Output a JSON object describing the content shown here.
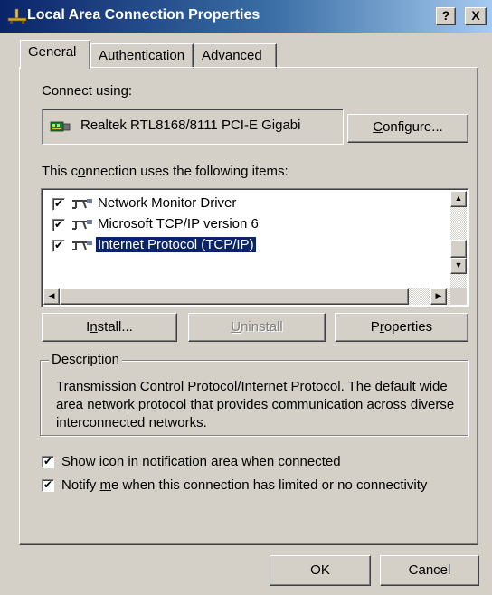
{
  "window": {
    "title": "Local Area Connection Properties"
  },
  "caption_buttons": {
    "help": "?",
    "close": "X"
  },
  "tabs": [
    {
      "label": "General"
    },
    {
      "label": "Authentication"
    },
    {
      "label": "Advanced"
    }
  ],
  "connect_using": {
    "label_pre": "C",
    "label_accel": "",
    "label_post": "onnect using:",
    "adapter": "Realtek RTL8168/8111 PCI-E Gigabi",
    "configure_pre": "",
    "configure_accel": "C",
    "configure_post": "onfigure..."
  },
  "items_label": {
    "pre": "This c",
    "accel": "o",
    "post": "nnection uses the following items:"
  },
  "items": [
    {
      "label": "Network Monitor Driver",
      "checked": true
    },
    {
      "label": "Microsoft TCP/IP version 6",
      "checked": true
    },
    {
      "label": "Internet Protocol (TCP/IP)",
      "checked": true,
      "selected": true
    }
  ],
  "check_mark": "✔",
  "buttons": {
    "install": {
      "pre": "I",
      "accel": "n",
      "post": "stall..."
    },
    "uninstall": {
      "pre": "",
      "accel": "U",
      "post": "ninstall"
    },
    "properties": {
      "pre": "P",
      "accel": "r",
      "post": "operties"
    },
    "ok": "OK",
    "cancel": "Cancel"
  },
  "description": {
    "legend": "Description",
    "text": "Transmission Control Protocol/Internet Protocol. The default wide area network protocol that provides communication across diverse interconnected networks."
  },
  "options": {
    "show_icon": {
      "pre": "Sho",
      "accel": "w",
      "post": " icon in notification area when connected",
      "checked": true
    },
    "notify": {
      "pre": "Notify ",
      "accel": "m",
      "post": "e when this connection has limited or no connectivity",
      "checked": true
    }
  },
  "icons": {
    "title": "network-connection-icon",
    "adapter": "network-card-icon",
    "item": "network-component-icon"
  },
  "colors": {
    "titlebar_start": "#0a246a",
    "titlebar_end": "#a6caf0",
    "face": "#d4d0c8",
    "selection": "#0a246a"
  }
}
